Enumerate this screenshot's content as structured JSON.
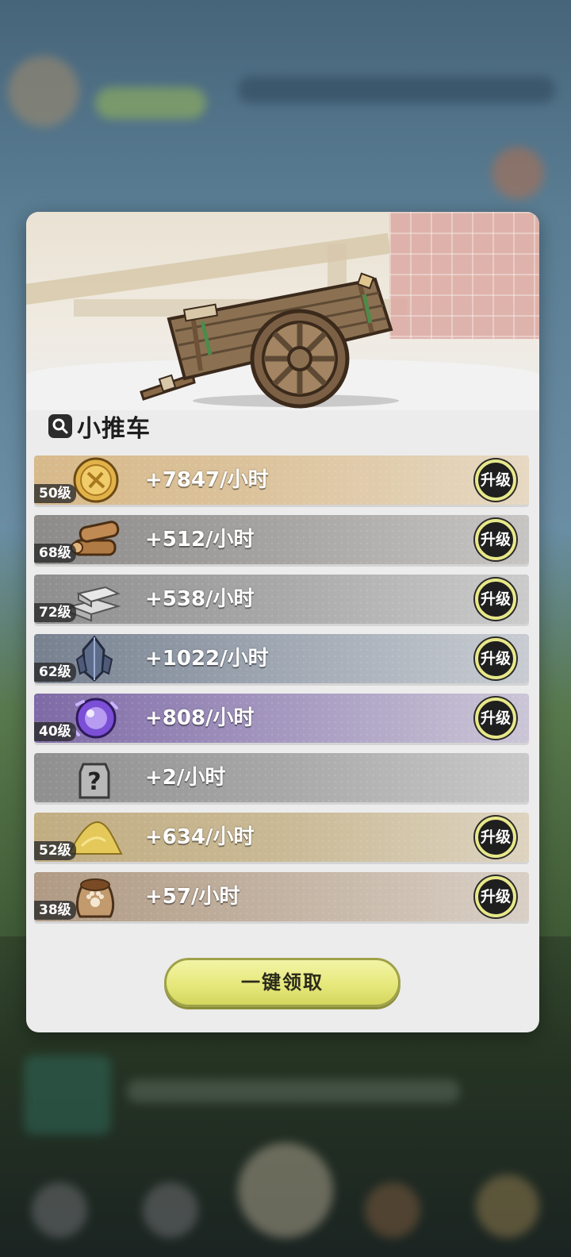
{
  "panel": {
    "title": "小推车",
    "search_icon": "search-icon",
    "claim_label": "一键领取"
  },
  "resources": [
    {
      "icon": "gold-coin-icon",
      "level": "50级",
      "rate": "+7847/小时",
      "upgrade": "升级"
    },
    {
      "icon": "wood-logs-icon",
      "level": "68级",
      "rate": "+512/小时",
      "upgrade": "升级"
    },
    {
      "icon": "stone-bricks-icon",
      "level": "72级",
      "rate": "+538/小时",
      "upgrade": "升级"
    },
    {
      "icon": "crystal-icon",
      "level": "62级",
      "rate": "+1022/小时",
      "upgrade": "升级"
    },
    {
      "icon": "purple-orb-icon",
      "level": "40级",
      "rate": "+808/小时",
      "upgrade": "升级"
    },
    {
      "icon": "mystery-box-icon",
      "level": "",
      "rate": "+2/小时",
      "upgrade": ""
    },
    {
      "icon": "sand-pile-icon",
      "level": "52级",
      "rate": "+634/小时",
      "upgrade": "升级"
    },
    {
      "icon": "food-sack-icon",
      "level": "38级",
      "rate": "+57/小时",
      "upgrade": "升级"
    }
  ],
  "colors": {
    "claim_button": "#e6e87c",
    "upgrade_ring": "#e8e88a",
    "modal_bg": "#ececec"
  }
}
